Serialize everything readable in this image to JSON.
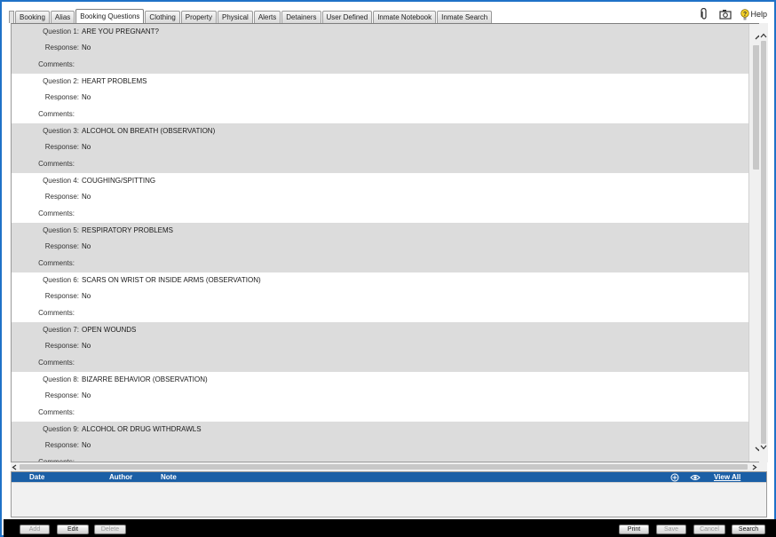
{
  "tabs": [
    {
      "label": "Booking",
      "active": false
    },
    {
      "label": "Alias",
      "active": false
    },
    {
      "label": "Booking Questions",
      "active": true
    },
    {
      "label": "Clothing",
      "active": false
    },
    {
      "label": "Property",
      "active": false
    },
    {
      "label": "Physical",
      "active": false
    },
    {
      "label": "Alerts",
      "active": false
    },
    {
      "label": "Detainers",
      "active": false
    },
    {
      "label": "User Defined",
      "active": false
    },
    {
      "label": "Inmate Notebook",
      "active": false
    },
    {
      "label": "Inmate Search",
      "active": false
    }
  ],
  "toolbar": {
    "help_label": "Help",
    "icons": [
      "paperclip-icon",
      "camera-icon",
      "help-icon"
    ]
  },
  "labels": {
    "response": "Response:",
    "comments": "Comments:"
  },
  "questions": [
    {
      "label": "Question 1:",
      "text": "ARE YOU PREGNANT?",
      "response": "No",
      "comments": ""
    },
    {
      "label": "Question 2:",
      "text": "HEART PROBLEMS",
      "response": "No",
      "comments": ""
    },
    {
      "label": "Question 3:",
      "text": "ALCOHOL ON BREATH (OBSERVATION)",
      "response": "No",
      "comments": ""
    },
    {
      "label": "Question 4:",
      "text": "COUGHING/SPITTING",
      "response": "No",
      "comments": ""
    },
    {
      "label": "Question 5:",
      "text": "RESPIRATORY PROBLEMS",
      "response": "No",
      "comments": ""
    },
    {
      "label": "Question 6:",
      "text": "SCARS ON WRIST OR INSIDE ARMS (OBSERVATION)",
      "response": "No",
      "comments": ""
    },
    {
      "label": "Question 7:",
      "text": "OPEN WOUNDS",
      "response": "No",
      "comments": ""
    },
    {
      "label": "Question 8:",
      "text": "BIZARRE BEHAVIOR (OBSERVATION)",
      "response": "No",
      "comments": ""
    },
    {
      "label": "Question 9:",
      "text": "ALCOHOL OR DRUG WITHDRAWLS",
      "response": "No",
      "comments": ""
    }
  ],
  "notes": {
    "columns": {
      "date": "Date",
      "author": "Author",
      "note": "Note"
    },
    "view_all": "View All",
    "rows": []
  },
  "buttons": {
    "add": {
      "label": "Add",
      "enabled": false
    },
    "edit": {
      "label": "Edit",
      "enabled": true
    },
    "delete": {
      "label": "Delete",
      "enabled": false
    },
    "print": {
      "label": "Print",
      "enabled": true
    },
    "save": {
      "label": "Save",
      "enabled": false
    },
    "cancel": {
      "label": "Cancel",
      "enabled": false
    },
    "search": {
      "label": "Search",
      "enabled": true
    }
  },
  "colors": {
    "frame_border": "#1f72c7",
    "notes_header": "#1b5fa6",
    "shaded_row": "#dcdcdc",
    "bottom_bar": "#000000"
  }
}
